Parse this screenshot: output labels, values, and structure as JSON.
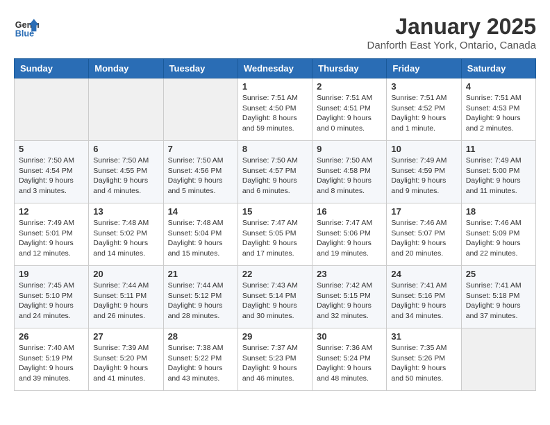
{
  "header": {
    "logo": {
      "line1": "General",
      "line2": "Blue"
    },
    "title": "January 2025",
    "subtitle": "Danforth East York, Ontario, Canada"
  },
  "weekdays": [
    "Sunday",
    "Monday",
    "Tuesday",
    "Wednesday",
    "Thursday",
    "Friday",
    "Saturday"
  ],
  "weeks": [
    [
      {
        "day": null
      },
      {
        "day": null
      },
      {
        "day": null
      },
      {
        "day": 1,
        "sunrise": "7:51 AM",
        "sunset": "4:50 PM",
        "daylight": "8 hours and 59 minutes."
      },
      {
        "day": 2,
        "sunrise": "7:51 AM",
        "sunset": "4:51 PM",
        "daylight": "9 hours and 0 minutes."
      },
      {
        "day": 3,
        "sunrise": "7:51 AM",
        "sunset": "4:52 PM",
        "daylight": "9 hours and 1 minute."
      },
      {
        "day": 4,
        "sunrise": "7:51 AM",
        "sunset": "4:53 PM",
        "daylight": "9 hours and 2 minutes."
      }
    ],
    [
      {
        "day": 5,
        "sunrise": "7:50 AM",
        "sunset": "4:54 PM",
        "daylight": "9 hours and 3 minutes."
      },
      {
        "day": 6,
        "sunrise": "7:50 AM",
        "sunset": "4:55 PM",
        "daylight": "9 hours and 4 minutes."
      },
      {
        "day": 7,
        "sunrise": "7:50 AM",
        "sunset": "4:56 PM",
        "daylight": "9 hours and 5 minutes."
      },
      {
        "day": 8,
        "sunrise": "7:50 AM",
        "sunset": "4:57 PM",
        "daylight": "9 hours and 6 minutes."
      },
      {
        "day": 9,
        "sunrise": "7:50 AM",
        "sunset": "4:58 PM",
        "daylight": "9 hours and 8 minutes."
      },
      {
        "day": 10,
        "sunrise": "7:49 AM",
        "sunset": "4:59 PM",
        "daylight": "9 hours and 9 minutes."
      },
      {
        "day": 11,
        "sunrise": "7:49 AM",
        "sunset": "5:00 PM",
        "daylight": "9 hours and 11 minutes."
      }
    ],
    [
      {
        "day": 12,
        "sunrise": "7:49 AM",
        "sunset": "5:01 PM",
        "daylight": "9 hours and 12 minutes."
      },
      {
        "day": 13,
        "sunrise": "7:48 AM",
        "sunset": "5:02 PM",
        "daylight": "9 hours and 14 minutes."
      },
      {
        "day": 14,
        "sunrise": "7:48 AM",
        "sunset": "5:04 PM",
        "daylight": "9 hours and 15 minutes."
      },
      {
        "day": 15,
        "sunrise": "7:47 AM",
        "sunset": "5:05 PM",
        "daylight": "9 hours and 17 minutes."
      },
      {
        "day": 16,
        "sunrise": "7:47 AM",
        "sunset": "5:06 PM",
        "daylight": "9 hours and 19 minutes."
      },
      {
        "day": 17,
        "sunrise": "7:46 AM",
        "sunset": "5:07 PM",
        "daylight": "9 hours and 20 minutes."
      },
      {
        "day": 18,
        "sunrise": "7:46 AM",
        "sunset": "5:09 PM",
        "daylight": "9 hours and 22 minutes."
      }
    ],
    [
      {
        "day": 19,
        "sunrise": "7:45 AM",
        "sunset": "5:10 PM",
        "daylight": "9 hours and 24 minutes."
      },
      {
        "day": 20,
        "sunrise": "7:44 AM",
        "sunset": "5:11 PM",
        "daylight": "9 hours and 26 minutes."
      },
      {
        "day": 21,
        "sunrise": "7:44 AM",
        "sunset": "5:12 PM",
        "daylight": "9 hours and 28 minutes."
      },
      {
        "day": 22,
        "sunrise": "7:43 AM",
        "sunset": "5:14 PM",
        "daylight": "9 hours and 30 minutes."
      },
      {
        "day": 23,
        "sunrise": "7:42 AM",
        "sunset": "5:15 PM",
        "daylight": "9 hours and 32 minutes."
      },
      {
        "day": 24,
        "sunrise": "7:41 AM",
        "sunset": "5:16 PM",
        "daylight": "9 hours and 34 minutes."
      },
      {
        "day": 25,
        "sunrise": "7:41 AM",
        "sunset": "5:18 PM",
        "daylight": "9 hours and 37 minutes."
      }
    ],
    [
      {
        "day": 26,
        "sunrise": "7:40 AM",
        "sunset": "5:19 PM",
        "daylight": "9 hours and 39 minutes."
      },
      {
        "day": 27,
        "sunrise": "7:39 AM",
        "sunset": "5:20 PM",
        "daylight": "9 hours and 41 minutes."
      },
      {
        "day": 28,
        "sunrise": "7:38 AM",
        "sunset": "5:22 PM",
        "daylight": "9 hours and 43 minutes."
      },
      {
        "day": 29,
        "sunrise": "7:37 AM",
        "sunset": "5:23 PM",
        "daylight": "9 hours and 46 minutes."
      },
      {
        "day": 30,
        "sunrise": "7:36 AM",
        "sunset": "5:24 PM",
        "daylight": "9 hours and 48 minutes."
      },
      {
        "day": 31,
        "sunrise": "7:35 AM",
        "sunset": "5:26 PM",
        "daylight": "9 hours and 50 minutes."
      },
      {
        "day": null
      }
    ]
  ],
  "labels": {
    "sunrise": "Sunrise:",
    "sunset": "Sunset:",
    "daylight": "Daylight hours"
  }
}
